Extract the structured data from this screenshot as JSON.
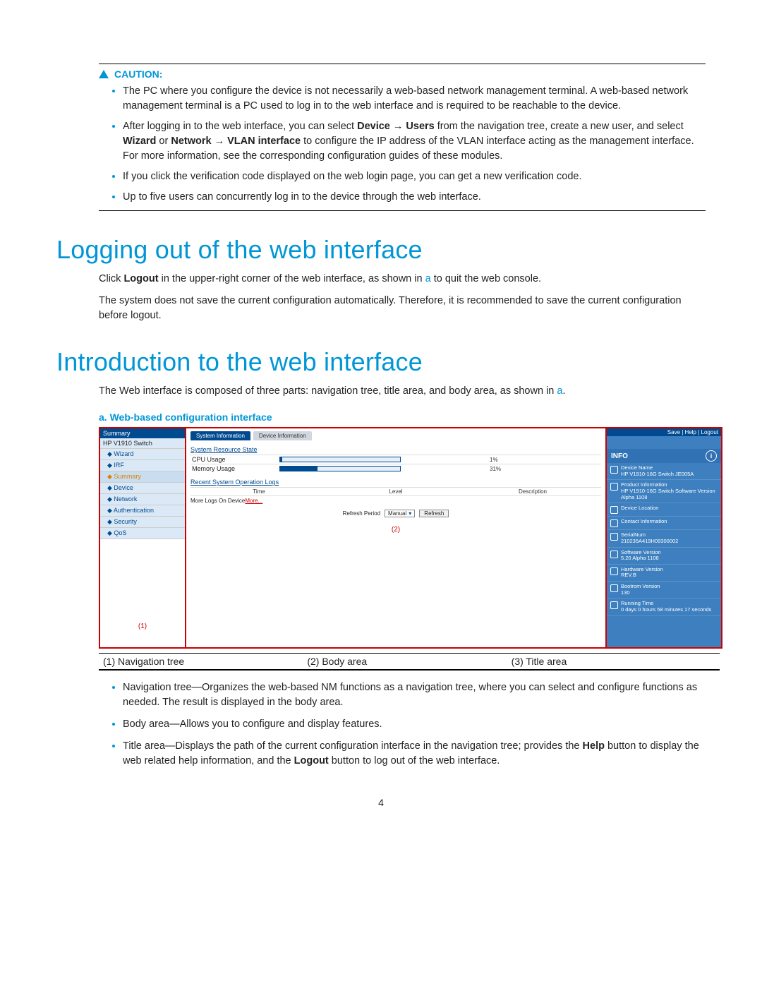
{
  "caution": {
    "label": "CAUTION:",
    "items": [
      "The PC where you configure the device is not necessarily a web-based network management terminal. A web-based network management terminal is a PC used to log in to the web interface and is required to be reachable to the device.",
      "__HTML2__",
      "If you click the verification code displayed on the web login page, you can get a new verification code.",
      "Up to five users can concurrently log in to the device through the web interface."
    ],
    "item2": {
      "pre": "After logging in to the web interface, you can select ",
      "b1": "Device",
      "arrow": " → ",
      "b2": "Users",
      "mid1": " from the navigation tree, create a new user, and select ",
      "b3": "Wizard",
      "or": " or ",
      "b4": "Network",
      "arrow2": " → ",
      "b5": "VLAN interface",
      "post": " to configure the IP address of the VLAN interface acting as the management interface. For more information, see the corresponding configuration guides of these modules."
    }
  },
  "sec1": {
    "title": "Logging out of the web interface",
    "p1a": "Click ",
    "p1b": "Logout",
    "p1c": " in the upper-right corner of the web interface, as shown in ",
    "p1d": "a",
    "p1e": " to quit the web console.",
    "p2": "The system does not save the current configuration automatically. Therefore, it is recommended to save the current configuration before logout."
  },
  "sec2": {
    "title": "Introduction to the web interface",
    "p1a": "The Web interface is composed of three parts: navigation tree, title area, and body area, as shown in ",
    "p1b": "a",
    "p1c": "."
  },
  "fig": {
    "label": "a.   Web-based configuration interface",
    "nav_header": "Summary",
    "nav_title": "HP V1910 Switch",
    "nav_items": [
      "Wizard",
      "IRF",
      "Summary",
      "Device",
      "Network",
      "Authentication",
      "Security",
      "QoS"
    ],
    "nav_sel_index": 2,
    "nav_num": "(1)",
    "tabs": [
      "System Information",
      "Device Information"
    ],
    "sec_res": "System Resource State",
    "cpu_label": "CPU Usage",
    "cpu_val": "1%",
    "mem_label": "Memory Usage",
    "mem_val": "31%",
    "sec_log": "Recent System Operation Logs",
    "log_cols": [
      "Time",
      "Level",
      "Description"
    ],
    "more_pre": "More Logs On Device",
    "more_link": "More...",
    "refresh_label": "Refresh Period",
    "refresh_sel": "Manual",
    "refresh_btn": "Refresh",
    "body_num": "(2)",
    "title_top": "Save | Help | Logout",
    "info_head": "INFO",
    "info": [
      {
        "l": "Device Name",
        "v": "HP V1910-16G Switch JE005A"
      },
      {
        "l": "Product Information",
        "v": "HP V1910-16G Switch Software Version Alpha 1108"
      },
      {
        "l": "Device Location",
        "v": ""
      },
      {
        "l": "Contact Information",
        "v": ""
      },
      {
        "l": "SerialNum",
        "v": "210235A419H09300002"
      },
      {
        "l": "Software Version",
        "v": "5.20 Alpha 1108"
      },
      {
        "l": "Hardware Version",
        "v": "REV.B"
      },
      {
        "l": "Bootrom Version",
        "v": "130"
      },
      {
        "l": "Running Time",
        "v": "0 days 0 hours 58 minutes 17 seconds"
      }
    ]
  },
  "legend": [
    "(1) Navigation tree",
    "(2) Body area",
    "(3) Title area"
  ],
  "feat": {
    "i1": "Navigation tree—Organizes the web-based NM functions as a navigation tree, where you can select and configure functions as needed. The result is displayed in the body area.",
    "i2": "Body area—Allows you to configure and display features.",
    "i3a": "Title area—Displays the path of the current configuration interface in the navigation tree; provides the ",
    "i3b": "Help",
    "i3c": " button to display the web related help information, and the ",
    "i3d": "Logout",
    "i3e": " button to log out of the web interface."
  },
  "page_num": "4"
}
